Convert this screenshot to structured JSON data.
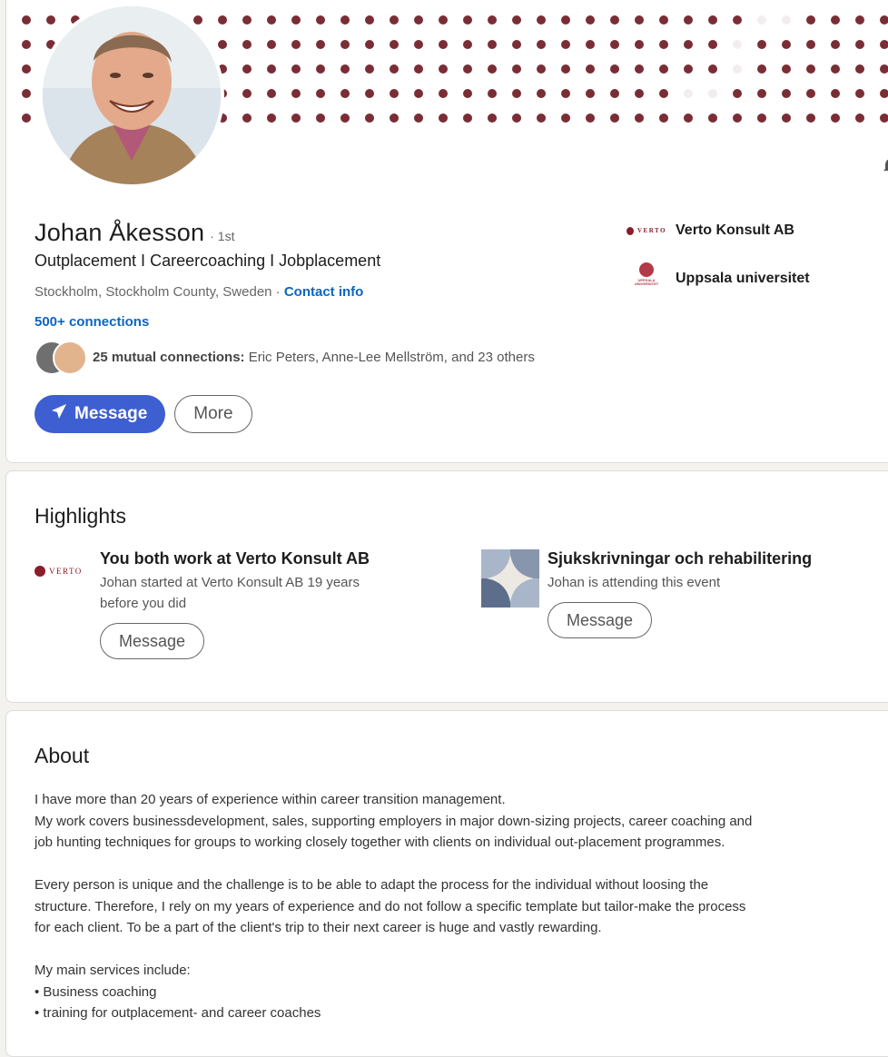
{
  "profile": {
    "name": "Johan Åkesson",
    "degree": "· 1st",
    "headline": "Outplacement I Careercoaching I Jobplacement",
    "location": "Stockholm, Stockholm County, Sweden · ",
    "contact_info": "Contact info",
    "connections": "500+ connections",
    "mutual_bold": "25 mutual connections:",
    "mutual_names": " Eric Peters, Anne-Lee Mellström, and 23 others",
    "message_label": "Message",
    "more_label": "More",
    "companies": [
      {
        "name": "Verto Konsult AB",
        "logo_text": "VERTO"
      },
      {
        "name": "Uppsala universitet",
        "logo_text": "UPPSALA UNIVERSITET"
      }
    ],
    "icons": {
      "send": "send-icon",
      "bell": "bell-icon"
    },
    "accent": "#3e5fd1",
    "banner_dot_color": "#7a2d35"
  },
  "highlights": {
    "title": "Highlights",
    "items": [
      {
        "logo_text": "VERTO",
        "title": "You both work at Verto Konsult AB",
        "subtitle_line1": "Johan started at Verto Konsult AB 19 years",
        "subtitle_line2": "before you did",
        "button": "Message"
      },
      {
        "title": "Sjukskrivningar och rehabilitering",
        "subtitle_line1": "Johan is attending this event",
        "button": "Message"
      }
    ]
  },
  "about": {
    "title": "About",
    "text": "I have more than 20 years of experience within career transition management.\nMy work covers businessdevelopment, sales, supporting employers in major down-sizing projects, career coaching and\njob hunting techniques for groups to working closely together with clients on individual out-placement programmes.\n\nEvery person is unique and the challenge is to be able to adapt the process for the individual without loosing the\nstructure. Therefore, I rely on my years of experience and do not follow a specific template but tailor-make the process\nfor each client. To be a part of the client's trip to their next career is huge and vastly rewarding.\n\nMy main services include:\n• Business coaching\n• training for outplacement- and career coaches"
  }
}
